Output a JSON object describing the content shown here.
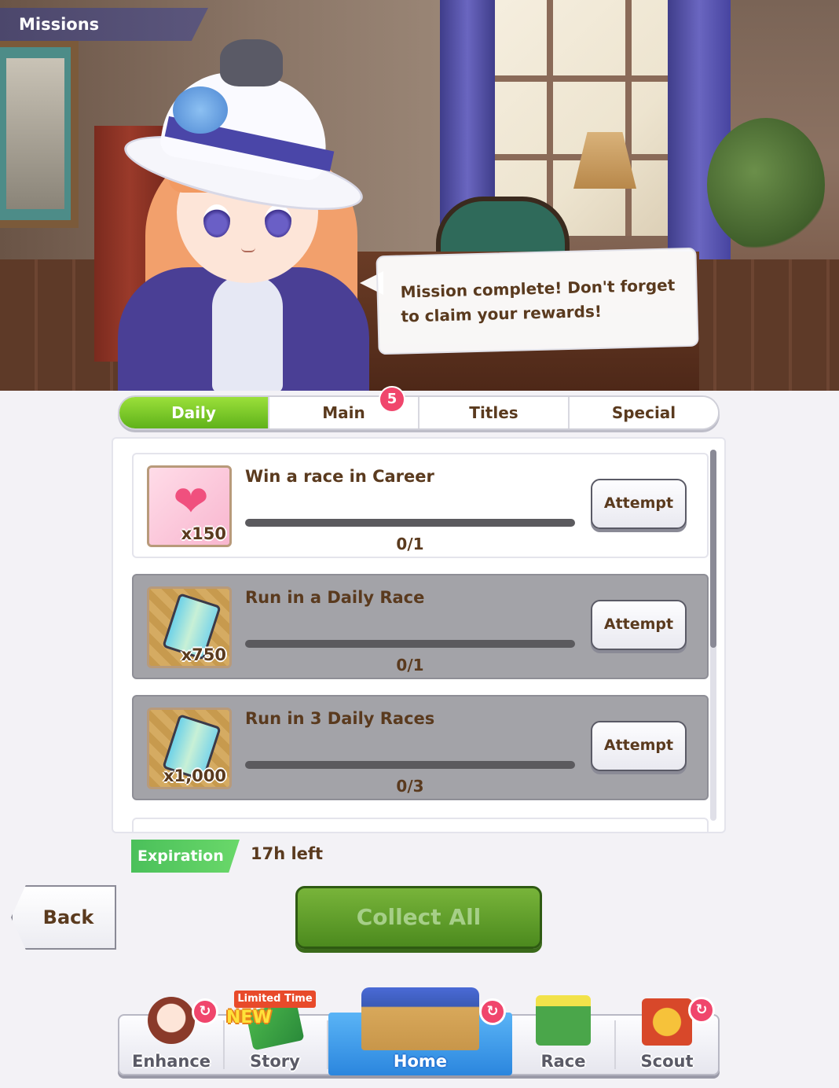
{
  "header": {
    "title": "Missions"
  },
  "dialogue": {
    "text": "Mission complete! Don't forget\nto claim your rewards!"
  },
  "tabs": [
    {
      "label": "Daily",
      "active": true
    },
    {
      "label": "Main",
      "badge": "5"
    },
    {
      "label": "Titles"
    },
    {
      "label": "Special"
    }
  ],
  "missions": [
    {
      "title": "Win a race in Career",
      "reward_icon": "friendship-points-icon",
      "reward_count": "x150",
      "progress": "0/1",
      "progress_fraction": 0,
      "button": "Attempt",
      "greyed": false
    },
    {
      "title": "Run in a Daily Race",
      "reward_icon": "support-card-ticket-icon",
      "reward_count": "x750",
      "progress": "0/1",
      "progress_fraction": 0,
      "button": "Attempt",
      "greyed": true
    },
    {
      "title": "Run in 3 Daily Races",
      "reward_icon": "support-card-ticket-icon",
      "reward_count": "x1,000",
      "progress": "0/3",
      "progress_fraction": 0,
      "button": "Attempt",
      "greyed": true
    }
  ],
  "expiration": {
    "label": "Expiration",
    "value": "17h left"
  },
  "buttons": {
    "back": "Back",
    "collect_all": "Collect All"
  },
  "bottom_nav": {
    "items": [
      {
        "label": "Enhance"
      },
      {
        "label": "Story",
        "tag": "Limited Time",
        "new": "NEW"
      },
      {
        "label": "Home",
        "active": true
      },
      {
        "label": "Race"
      },
      {
        "label": "Scout"
      }
    ]
  },
  "colors": {
    "tab_active": "#6cc422",
    "badge": "#f0466c",
    "collect_button": "#5a9a28",
    "expiration_tag": "#4ac05a",
    "greyed_row": "#a3a3a8",
    "text": "#5a3a1e"
  }
}
